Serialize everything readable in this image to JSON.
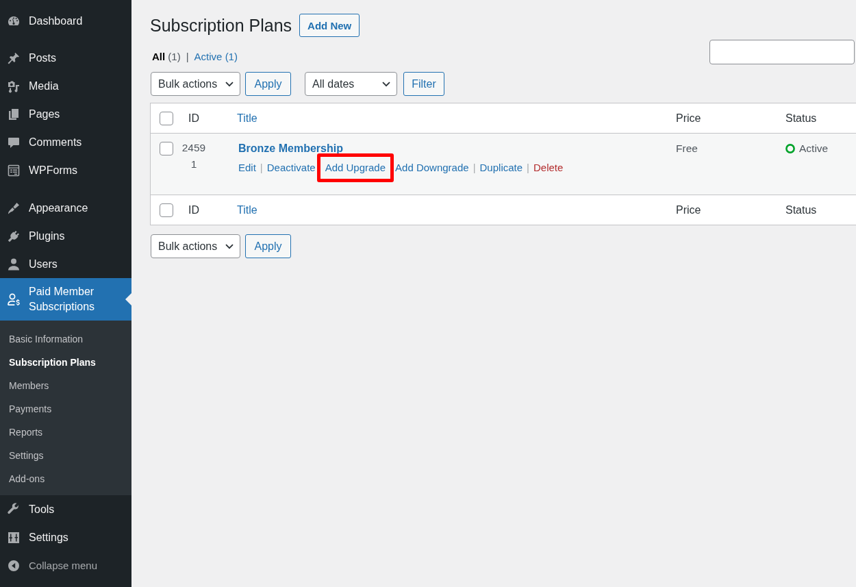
{
  "sidebar": {
    "groups": [
      {
        "items": [
          {
            "label": "Dashboard",
            "selected": false
          }
        ]
      },
      {
        "items": [
          {
            "label": "Posts",
            "selected": false
          },
          {
            "label": "Media",
            "selected": false
          },
          {
            "label": "Pages",
            "selected": false
          },
          {
            "label": "Comments",
            "selected": false
          },
          {
            "label": "WPForms",
            "selected": false
          }
        ]
      },
      {
        "items": [
          {
            "label": "Appearance",
            "selected": false
          },
          {
            "label": "Plugins",
            "selected": false
          },
          {
            "label": "Users",
            "selected": false
          },
          {
            "label": "Paid Member Subscriptions",
            "selected": true,
            "children": [
              {
                "label": "Basic Information",
                "selected": false
              },
              {
                "label": "Subscription Plans",
                "selected": true
              },
              {
                "label": "Members",
                "selected": false
              },
              {
                "label": "Payments",
                "selected": false
              },
              {
                "label": "Reports",
                "selected": false
              },
              {
                "label": "Settings",
                "selected": false
              },
              {
                "label": "Add-ons",
                "selected": false
              }
            ]
          },
          {
            "label": "Tools",
            "selected": false
          },
          {
            "label": "Settings",
            "selected": false
          }
        ]
      }
    ],
    "collapse_button": {
      "label": "Collapse menu"
    }
  },
  "page": {
    "title": "Subscription Plans",
    "add_new_button": "Add New",
    "views": [
      {
        "label": "All",
        "count": "(1)",
        "selected": true,
        "separator": "|"
      },
      {
        "label": "Active",
        "count": "(1)",
        "selected": false
      }
    ],
    "top_actions": {
      "bulk_actions": "Bulk actions",
      "apply_button": "Apply",
      "date_filter": "All dates",
      "filter_button": "Filter"
    },
    "table": {
      "header": {
        "checked": false,
        "columns": [
          {
            "label": "ID",
            "sortable": false
          },
          {
            "label": "Title",
            "sortable": true
          },
          {
            "label": "Price",
            "sortable": false
          },
          {
            "label": "Status",
            "sortable": false
          }
        ]
      },
      "rows": [
        {
          "checked": false,
          "id": "24591",
          "title": "Bronze Membership",
          "actions": [
            {
              "label": "Edit",
              "kind": "link",
              "highlighted": false,
              "separator": "|"
            },
            {
              "label": "Deactivate",
              "kind": "link",
              "highlighted": false
            },
            {
              "label": "Add Upgrade",
              "kind": "link",
              "highlighted": true
            },
            {
              "label": "Add Downgrade",
              "kind": "link",
              "highlighted": false,
              "separator": "|"
            },
            {
              "label": "Duplicate",
              "kind": "link",
              "highlighted": false,
              "separator": "|"
            },
            {
              "label": "Delete",
              "kind": "delete",
              "highlighted": false
            }
          ],
          "price": "Free",
          "status": "Active"
        }
      ],
      "footer": {
        "checked": false,
        "columns": [
          {
            "label": "ID",
            "sortable": false
          },
          {
            "label": "Title",
            "sortable": true
          },
          {
            "label": "Price",
            "sortable": false
          },
          {
            "label": "Status",
            "sortable": false
          }
        ]
      }
    },
    "bottom_actions": {
      "bulk_actions": "Bulk actions",
      "apply_button": "Apply"
    }
  }
}
